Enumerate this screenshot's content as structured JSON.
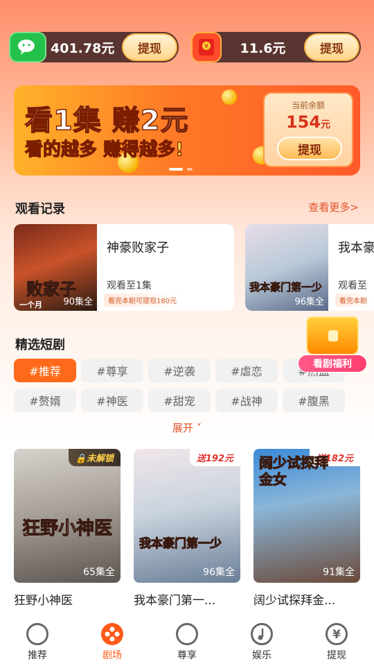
{
  "balances": {
    "wechat_amount": "401.78元",
    "wechat_withdraw": "提现",
    "redpacket_amount": "11.6元",
    "redpacket_withdraw": "提现"
  },
  "banner": {
    "line1": "看1集 赚2元",
    "line2_a": "看的",
    "line2_b": "越多",
    "line2_c": " 赚得",
    "line2_d": "越多!",
    "balance_label": "当前余额",
    "balance_value": "154",
    "balance_unit": "元",
    "withdraw": "提现"
  },
  "history": {
    "title": "观看记录",
    "more": "查看更多>",
    "items": [
      {
        "name": "神豪败家子",
        "progress": "观看至1集",
        "tip": "看完本剧可提现180元",
        "episodes": "90集全",
        "poster_text": "败家子",
        "poster_sub": "一个月"
      },
      {
        "name": "我本豪",
        "progress": "观看至",
        "tip": "看完本剧",
        "episodes": "96集全",
        "poster_text": "我本豪门第一少"
      }
    ]
  },
  "featured": {
    "title": "精选短剧",
    "welfare": "看剧福利",
    "expand": "展开",
    "tags": [
      "#推荐",
      "#尊享",
      "#逆袭",
      "#虐恋",
      "#热血",
      "#赘婿",
      "#神医",
      "#甜宠",
      "#战神",
      "#腹黑"
    ],
    "cards": [
      {
        "title": "狂野小神医",
        "episodes": "65集全",
        "badge": "未解锁",
        "poster_text": "狂野小神医"
      },
      {
        "title": "我本豪门第一...",
        "episodes": "96集全",
        "badge": "送192元",
        "poster_text": "我本豪门第一少"
      },
      {
        "title": "阔少试探拜金...",
        "episodes": "91集全",
        "badge": "送182元",
        "poster_text": "阔少试探拜金女"
      }
    ]
  },
  "tabbar": [
    "推荐",
    "剧场",
    "尊享",
    "娱乐",
    "提现"
  ],
  "colors": {
    "accent": "#ff5a1a",
    "link": "#e0532a"
  }
}
